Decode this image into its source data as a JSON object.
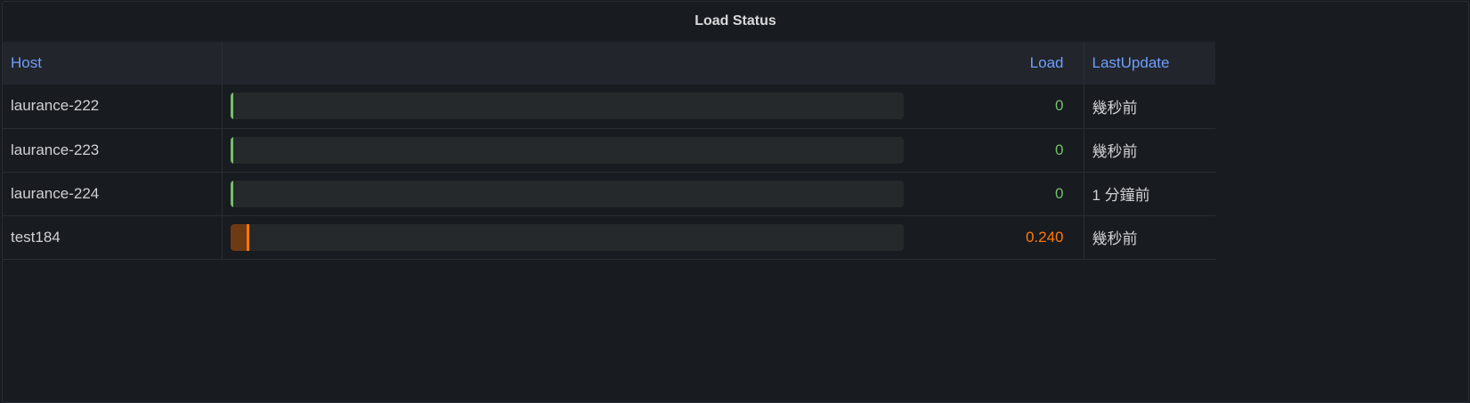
{
  "title": "Load Status",
  "columns": {
    "host": "Host",
    "load": "Load",
    "last_update": "LastUpdate"
  },
  "max_load": 10,
  "colors": {
    "ok": "#73bf69",
    "warn": "#ff780a",
    "warn_fill": "#6e3a14"
  },
  "rows": [
    {
      "host": "laurance-222",
      "load": "0",
      "load_value": 0,
      "status": "ok",
      "last_update": "幾秒前"
    },
    {
      "host": "laurance-223",
      "load": "0",
      "load_value": 0,
      "status": "ok",
      "last_update": "幾秒前"
    },
    {
      "host": "laurance-224",
      "load": "0",
      "load_value": 0,
      "status": "ok",
      "last_update": "1 分鐘前"
    },
    {
      "host": "test184",
      "load": "0.240",
      "load_value": 0.24,
      "status": "warn",
      "last_update": "幾秒前"
    }
  ]
}
